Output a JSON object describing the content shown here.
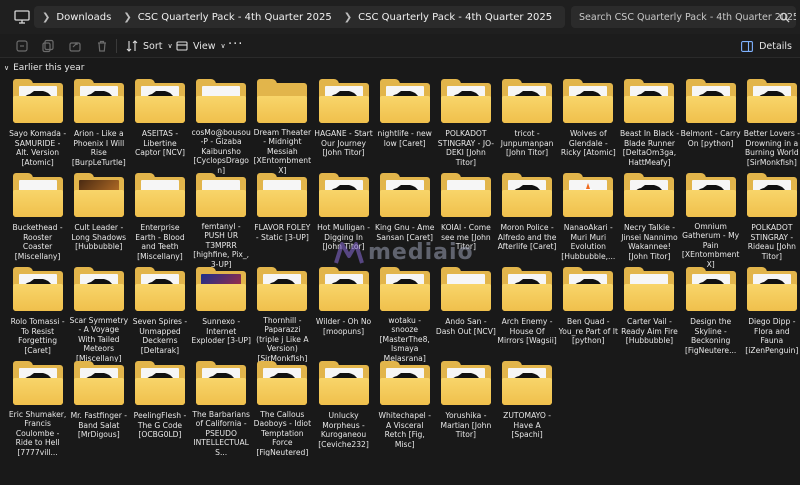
{
  "address": {
    "crumbs": [
      "Downloads",
      "CSC Quarterly Pack - 4th Quarter 2025",
      "CSC Quarterly Pack - 4th Quarter 2025"
    ]
  },
  "search": {
    "placeholder": "Search CSC Quarterly Pack - 4th Quarter 2025"
  },
  "toolbar": {
    "sort_label": "Sort",
    "view_label": "View",
    "more_label": "···",
    "details_label": "Details"
  },
  "group": {
    "label": "Earlier this year"
  },
  "watermark": "mediaio",
  "items": [
    {
      "name": "Sayo Komada - SAMURIDE - Alt. Version [Atomic]",
      "thumb": "car"
    },
    {
      "name": "Arion - Like a Phoenix I Will Rise [BurpLeTurtle]",
      "thumb": "car"
    },
    {
      "name": "ASEITAS - Libertine Captor [NCV]",
      "thumb": "car"
    },
    {
      "name": "cosMo@bousou-P - Gizaba Kaibunsho [CyclopsDragon]",
      "thumb": "blank"
    },
    {
      "name": "Dream Theater - Midnight Messiah [XEntombmentX]",
      "thumb": "plain"
    },
    {
      "name": "HAGANE - Start Our Journey [John Titor]",
      "thumb": "car"
    },
    {
      "name": "nightlife - new low [Caret]",
      "thumb": "car"
    },
    {
      "name": "POLKADOT STINGRAY - JO-DEKI [John Titor]",
      "thumb": "car"
    },
    {
      "name": "tricot - Junpumanpan [John Titor]",
      "thumb": "car"
    },
    {
      "name": "Wolves of Glendale - Ricky [Atomic]",
      "thumb": "car"
    },
    {
      "name": "Beast In Black - Blade Runner [DeltaOm3ga, HattMeafy]",
      "thumb": "car"
    },
    {
      "name": "Belmont - Carry On [python]",
      "thumb": "car"
    },
    {
      "name": "Better Lovers - Drowning in a Burning World [SirMonkfish]",
      "thumb": "car"
    },
    {
      "name": "Buckethead - Rooster Coaster [Miscellany]",
      "thumb": "blank"
    },
    {
      "name": "Cult Leader - Long Shadows [Hubbubble]",
      "thumb": "art-brown"
    },
    {
      "name": "Enterprise Earth - Blood and Teeth [Miscellany]",
      "thumb": "blank"
    },
    {
      "name": "femtanyl - PUSH UR T3MPRR [highfine, Pix_, 3-UP]",
      "thumb": "blank"
    },
    {
      "name": "FLAVOR FOLEY - Static [3-UP]",
      "thumb": "blank"
    },
    {
      "name": "Hot Mulligan - Digging In [John Titor]",
      "thumb": "car"
    },
    {
      "name": "King Gnu - Ame Sansan [Caret]",
      "thumb": "car"
    },
    {
      "name": "KOIAI - Come see me [John Titor]",
      "thumb": "blank"
    },
    {
      "name": "Moron Police - Alfredo and the Afterlife [Caret]",
      "thumb": "car"
    },
    {
      "name": "NanaoAkari - Muri Muri Evolution [Hubbubble,...",
      "thumb": "cone"
    },
    {
      "name": "Necry Talkie - Jinsei Nannimo Wakannee! [John Titor]",
      "thumb": "car"
    },
    {
      "name": "Omnium Gatherum - My Pain [XEntombmentX]",
      "thumb": "car"
    },
    {
      "name": "POLKADOT STINGRAY - Rideau [John Titor]",
      "thumb": "car"
    },
    {
      "name": "Rolo Tomassi - To Resist Forgetting [Caret]",
      "thumb": "car"
    },
    {
      "name": "Scar Symmetry - A Voyage With Tailed Meteors [Miscellany]",
      "thumb": "car"
    },
    {
      "name": "Seven Spires - Unmapped Deckerns [Deltarak]",
      "thumb": "car"
    },
    {
      "name": "Sunnexo - Internet Exploder [3-UP]",
      "thumb": "art-blue"
    },
    {
      "name": "Thornhill - Paparazzi (triple j Like A Version) [SirMonkfish]",
      "thumb": "car"
    },
    {
      "name": "Wilder - Oh No [moopuns]",
      "thumb": "car"
    },
    {
      "name": "wotaku - snooze [MasterThe8, Ismaya Melasrana]",
      "thumb": "car"
    },
    {
      "name": "Ando San - Dash Out [NCV]",
      "thumb": "blank"
    },
    {
      "name": "Arch Enemy - House Of Mirrors [Wagsii]",
      "thumb": "car"
    },
    {
      "name": "Ben Quad - You_re Part of It [python]",
      "thumb": "car"
    },
    {
      "name": "Carter Vail - Ready Aim Fire [Hubbubble]",
      "thumb": "blank"
    },
    {
      "name": "Design the Skyline - Beckoning [FigNeutere...",
      "thumb": "car"
    },
    {
      "name": "Diego Dipp - Flora and Fauna [iZenPenguin]",
      "thumb": "car"
    },
    {
      "name": "Eric Shumaker, Francis Coulombe - Ride to Hell [7777vill...",
      "thumb": "car"
    },
    {
      "name": "Mr. Fastfinger - Band Salat [MrDigous]",
      "thumb": "car"
    },
    {
      "name": "PeelingFlesh - The G Code [OCBG0LD]",
      "thumb": "car"
    },
    {
      "name": "The Barbarians of California - PSEUDO INTELLECTUALS...",
      "thumb": "car"
    },
    {
      "name": "The Callous Daoboys - Idiot Temptation Force [FigNeutered]",
      "thumb": "car"
    },
    {
      "name": "Unlucky Morpheus - Kuroganeou [Ceviche232]",
      "thumb": "car"
    },
    {
      "name": "Whitechapel - A Visceral Retch [Fig, Misc]",
      "thumb": "car"
    },
    {
      "name": "Yorushika - Martian [John Titor]",
      "thumb": "car"
    },
    {
      "name": "ZUTOMAYO - Have A [Spachi]",
      "thumb": "car"
    }
  ]
}
